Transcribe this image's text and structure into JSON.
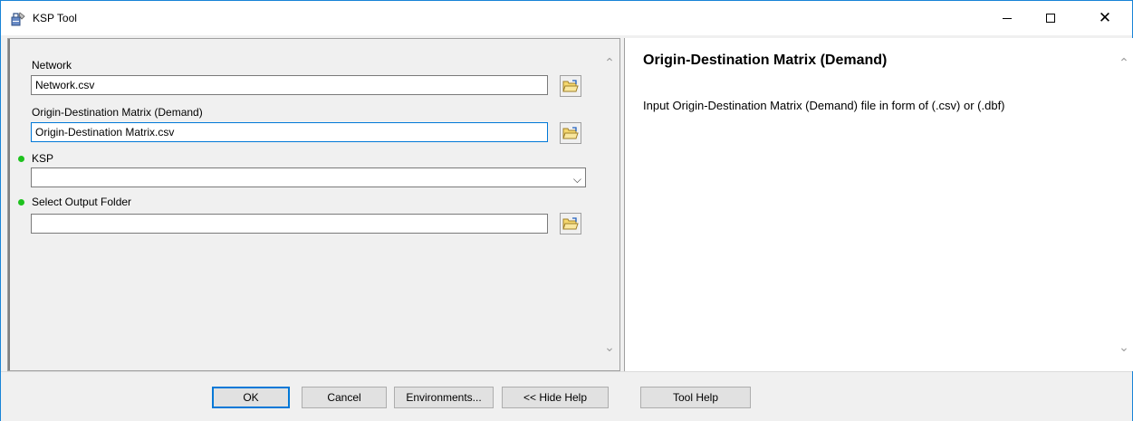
{
  "window": {
    "title": "KSP Tool",
    "app_icon": "toolbox-icon",
    "controls": {
      "minimize": "minimize-icon",
      "maximize": "maximize-icon",
      "close": "close-icon"
    }
  },
  "form": {
    "network": {
      "label": "Network",
      "value": "Network.csv"
    },
    "od_matrix": {
      "label": "Origin-Destination Matrix (Demand)",
      "value": "Origin-Destination Matrix.csv"
    },
    "ksp": {
      "label": "KSP",
      "value": ""
    },
    "output_folder": {
      "label": "Select Output Folder",
      "value": ""
    },
    "required_indicator_color": "#1ec21e"
  },
  "help": {
    "title": "Origin-Destination Matrix (Demand)",
    "text": "Input Origin-Destination Matrix (Demand) file in form of (.csv) or (.dbf)"
  },
  "buttons": {
    "ok": "OK",
    "cancel": "Cancel",
    "environments": "Environments...",
    "hide_help": "<< Hide Help",
    "tool_help": "Tool Help"
  },
  "colors": {
    "accent": "#0078d7"
  }
}
